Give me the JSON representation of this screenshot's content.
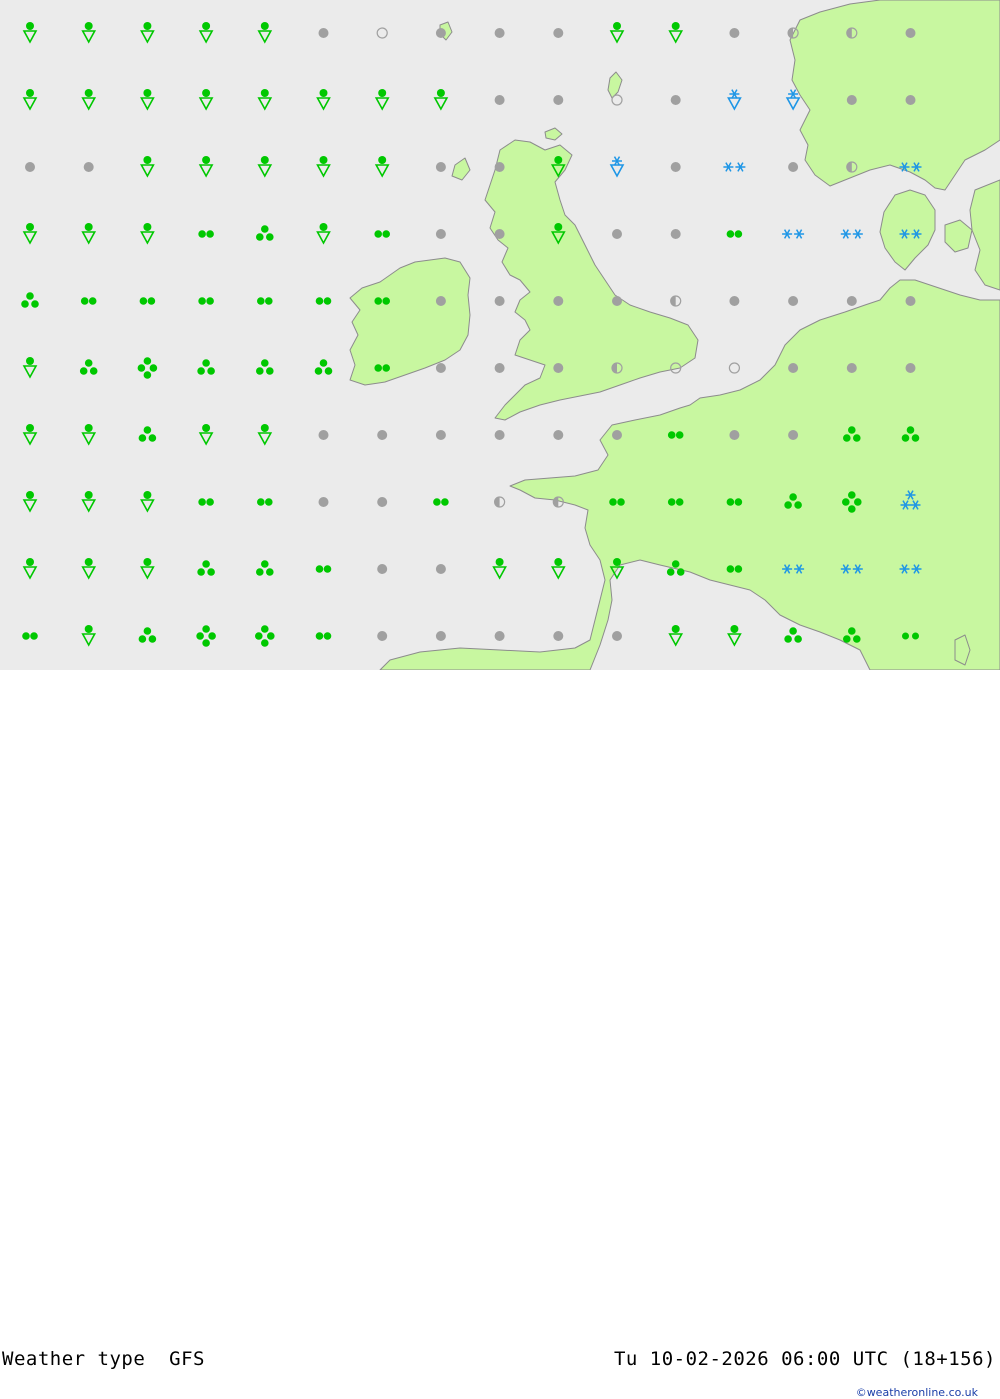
{
  "title": "Weather type",
  "model": "GFS",
  "datetime": "Tu 10-02-2026 06:00 UTC (18+156)",
  "credit": "©weatheronline.co.uk",
  "colors": {
    "sea": "#ebebeb",
    "land": "#c8f7a0",
    "coast": "#8c8c8c",
    "rain": "#00c800",
    "snow": "#1e96e6",
    "cloud": "#a0a0a0"
  },
  "legend_codes": {
    "d": "heavy clouds / overcast (grey dot)",
    "c": "clear (grey ring)",
    "h": "partly cloudy (half dot)",
    "s": "rain shower",
    "2": "light rain (two dots)",
    "3": "moderate rain (three dots)",
    "4": "heavy rain (four dots)",
    "S": "snow shower",
    "*": "snow (two flakes)",
    "X": "heavy snow",
    "r": "rain and snow"
  },
  "grid": [
    "sssssdcdddssdhhd",
    "ssssssssddcdSSdd",
    "ddsssssddsSd*dh*",
    "sss23s2dds dd2***",
    "3222222ddddhdddd",
    "s343332dddhccddd",
    "ss3ssdddddd2dd33",
    "sss22dd2hh2223 4X3",
    "sss332ddsss32***",
    "2s3442dddddss33r4"
  ]
}
